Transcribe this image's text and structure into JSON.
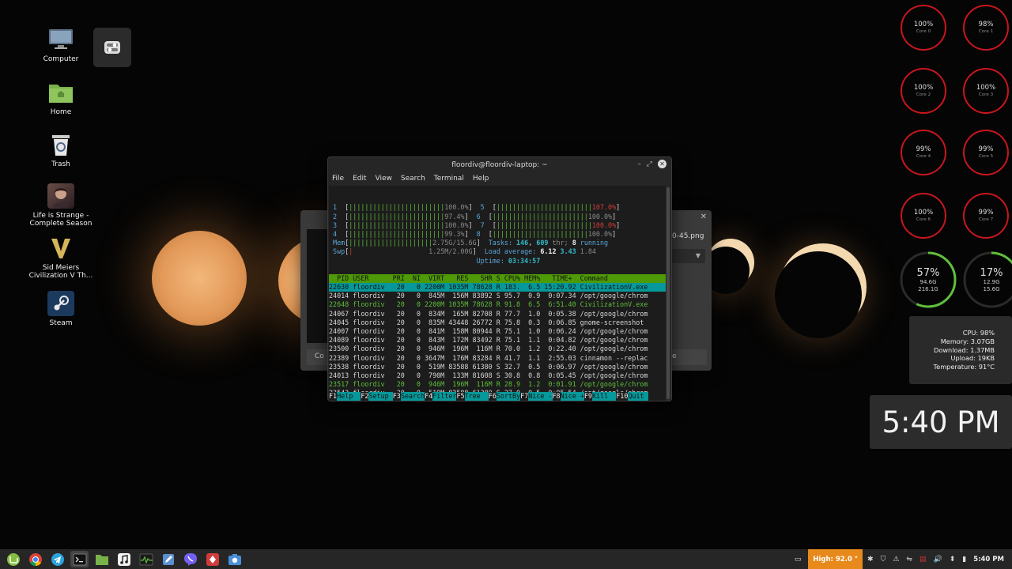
{
  "desktop": {
    "icons": [
      {
        "label": "Computer"
      },
      {
        "label": "Home"
      },
      {
        "label": "Trash"
      },
      {
        "label": "Life is Strange - Complete Season"
      },
      {
        "label": "Sid Meiers Civilization V Th..."
      },
      {
        "label": "Steam"
      }
    ]
  },
  "background_window": {
    "file_label": "0-45.png",
    "button_left": "Co",
    "button_right": "e"
  },
  "terminal": {
    "title": "floordiv@floordiv-laptop: ~",
    "menu": [
      "File",
      "Edit",
      "View",
      "Search",
      "Terminal",
      "Help"
    ],
    "cpu_bars": [
      {
        "num": "1",
        "bar": "||||||||||||||||||||||||",
        "val": "100.0%"
      },
      {
        "num": "2",
        "bar": "||||||||||||||||||||||||",
        "val": "97.4%"
      },
      {
        "num": "3",
        "bar": "||||||||||||||||||||||||",
        "val": "100.0%"
      },
      {
        "num": "4",
        "bar": "||||||||||||||||||||||||",
        "val": "99.3%"
      },
      {
        "num": "5",
        "bar": "||||||||||||||||||||||||",
        "val": "107.0%"
      },
      {
        "num": "6",
        "bar": "||||||||||||||||||||||||",
        "val": "100.0%"
      },
      {
        "num": "7",
        "bar": "||||||||||||||||||||||||",
        "val": "100.0%"
      },
      {
        "num": "8",
        "bar": "||||||||||||||||||||||||",
        "val": "100.0%"
      }
    ],
    "mem_label": "Mem",
    "mem_bar": "|||||||||||||||||||||",
    "mem_val": "2.75G/15.6G",
    "swp_label": "Swp",
    "swp_val": "1.25M/2.00G",
    "tasks_label": "Tasks:",
    "tasks_count": "146",
    "thr_count": "609",
    "thr_label": "thr;",
    "running_count": "8",
    "running_label": "running",
    "load_label": "Load average:",
    "load_1": "6.12",
    "load_5": "3.43",
    "load_15": "1.84",
    "uptime_label": "Uptime:",
    "uptime": "03:34:57",
    "columns": "  PID USER      PRI  NI  VIRT   RES   SHR S CPU% MEM%   TIME+  Command",
    "processes": [
      "22630 floordiv   20   0 2200M 1035M 78628 R 183.  6.5 15:20.92 CivilizationV.exe",
      "24014 floordiv   20   0  845M  156M 83892 S 95.7  0.9  0:07.34 /opt/google/chrom",
      "22648 floordiv   20   0 2200M 1035M 78628 R 91.8  6.5  6:51.40 CivilizationV.exe",
      "24067 floordiv   20   0  834M  165M 82708 R 77.7  1.0  0:05.38 /opt/google/chrom",
      "24045 floordiv   20   0  835M 43448 26772 R 75.8  0.3  0:06.85 gnome-screenshot",
      "24007 floordiv   20   0  841M  158M 80944 R 75.1  1.0  0:06.24 /opt/google/chrom",
      "24089 floordiv   20   0  843M  172M 83492 R 75.1  1.1  0:04.82 /opt/google/chrom",
      "23500 floordiv   20   0  946M  196M  116M R 70.0  1.2  0:22.40 /opt/google/chrom",
      "22389 floordiv   20   0 3647M  176M 83284 R 41.7  1.1  2:55.03 cinnamon --replac",
      "23538 floordiv   20   0  519M 83588 61380 S 32.7  0.5  0:06.97 /opt/google/chrom",
      "24013 floordiv   20   0  790M  133M 81608 S 30.8  0.8  0:05.45 /opt/google/chrom",
      "23517 floordiv   20   0  946M  196M  116M R 28.9  1.2  0:01.91 /opt/google/chrom",
      "23543 floordiv   20   0  519M 83588 61380 S 27.0  0.5  0:05.54 /opt/google/chrom"
    ],
    "fkeys": [
      {
        "key": "F1",
        "label": "Help  "
      },
      {
        "key": "F2",
        "label": "Setup "
      },
      {
        "key": "F3",
        "label": "Search"
      },
      {
        "key": "F4",
        "label": "Filter"
      },
      {
        "key": "F5",
        "label": "Tree  "
      },
      {
        "key": "F6",
        "label": "SortBy"
      },
      {
        "key": "F7",
        "label": "Nice -"
      },
      {
        "key": "F8",
        "label": "Nice +"
      },
      {
        "key": "F9",
        "label": "Kill  "
      },
      {
        "key": "F10",
        "label": "Quit "
      }
    ]
  },
  "cores": [
    {
      "pct": "100%",
      "label": "Core 0"
    },
    {
      "pct": "98%",
      "label": "Core 1"
    },
    {
      "pct": "100%",
      "label": "Core 2"
    },
    {
      "pct": "100%",
      "label": "Core 3"
    },
    {
      "pct": "99%",
      "label": "Core 4"
    },
    {
      "pct": "99%",
      "label": "Core 5"
    },
    {
      "pct": "100%",
      "label": "Core 6"
    },
    {
      "pct": "99%",
      "label": "Core 7"
    }
  ],
  "disks": [
    {
      "pct": "57%",
      "used": "94.6G",
      "total": "216.1G",
      "fraction": 0.57
    },
    {
      "pct": "17%",
      "used": "12.9G",
      "total": "15.6G",
      "fraction": 0.17
    }
  ],
  "stats": {
    "cpu": "CPU: 98%",
    "memory": "Memory: 3.07GB",
    "download": "Download: 1.37MB",
    "upload": "Upload: 19KB",
    "temperature": "Temperature: 91°C"
  },
  "clock": "5:40 PM",
  "taskbar": {
    "high_temp": "High: 92.0 °",
    "time": "5:40 PM"
  },
  "colors": {
    "accent_red": "#c8161c",
    "disk_green": "#5fbf3a",
    "htop_green": "#4e9a06",
    "htop_cyan": "#06989a",
    "warning_orange": "#e8891c"
  }
}
